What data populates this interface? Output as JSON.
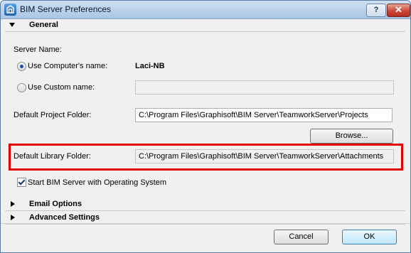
{
  "window": {
    "title": "BIM Server Preferences",
    "help_label": "?",
    "close_label": "✕"
  },
  "general": {
    "header": "General",
    "server_name_label": "Server Name:",
    "use_computer_label": "Use Computer's name:",
    "computer_name": "Laci-NB",
    "use_custom_label": "Use Custom name:",
    "custom_name_value": "",
    "default_project_label": "Default Project Folder:",
    "default_project_value": "C:\\Program Files\\Graphisoft\\BIM Server\\TeamworkServer\\Projects",
    "browse_label": "Browse...",
    "default_library_label": "Default Library Folder:",
    "default_library_value": "C:\\Program Files\\Graphisoft\\BIM Server\\TeamworkServer\\Attachments",
    "start_with_os_label": "Start BIM Server with Operating System",
    "start_with_os_checked": true,
    "use_computer_selected": true
  },
  "email_options": {
    "header": "Email Options"
  },
  "advanced_settings": {
    "header": "Advanced Settings"
  },
  "footer": {
    "cancel_label": "Cancel",
    "ok_label": "OK"
  },
  "colors": {
    "highlight": "#e20000",
    "titlebar": "#b9d1ea"
  }
}
